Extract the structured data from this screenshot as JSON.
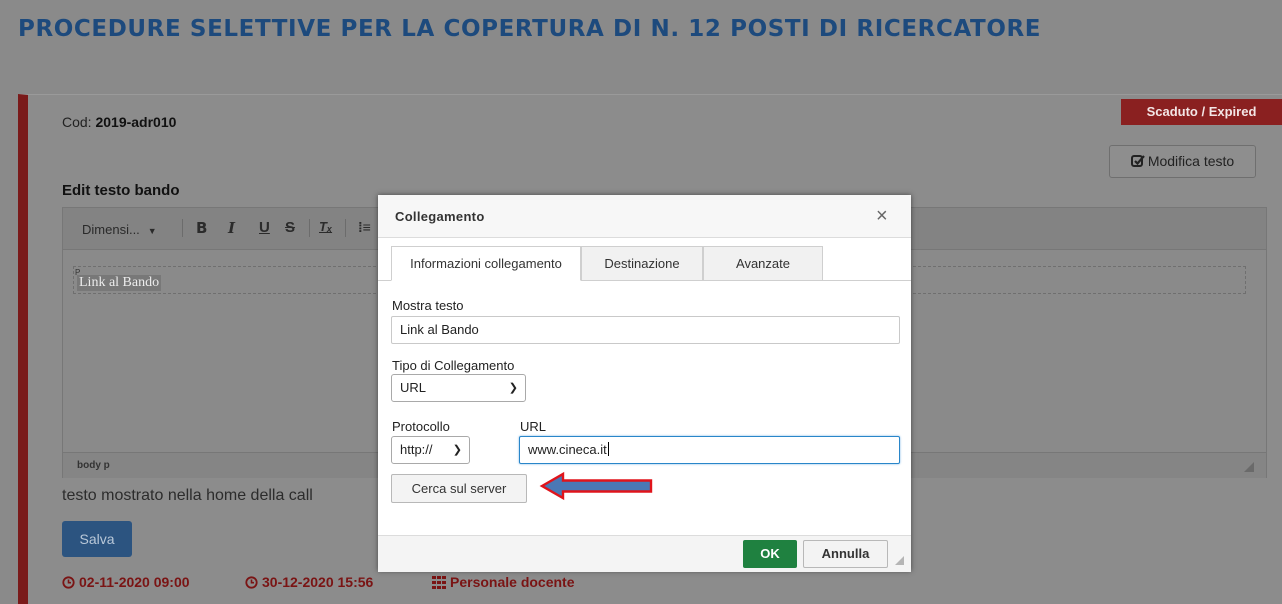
{
  "page": {
    "title": "PROCEDURE SELETTIVE PER LA COPERTURA DI N. 12 POSTI DI RICERCATORE"
  },
  "card": {
    "cod_label": "Cod:",
    "cod_value": "2019-adr010",
    "status_badge": "Scaduto / Expired",
    "modifica_label": "Modifica testo",
    "edit_label": "Edit testo bando",
    "hint": "testo mostrato nella home della call",
    "save_label": "Salva",
    "start_datetime": "02-11-2020 09:00",
    "end_datetime": "30-12-2020 15:56",
    "category": "Personale docente"
  },
  "editor": {
    "font_size_combo": "Dimensi...",
    "toolbar_buttons": [
      "B",
      "I",
      "U",
      "S",
      "Tx",
      "list"
    ],
    "p_marker": "P",
    "content_text": "Link al Bando",
    "status_path": "body  p"
  },
  "dialog": {
    "title": "Collegamento",
    "close_glyph": "×",
    "tabs": [
      {
        "label": "Informazioni collegamento",
        "active": true
      },
      {
        "label": "Destinazione",
        "active": false
      },
      {
        "label": "Avanzate",
        "active": false
      }
    ],
    "display_text_label": "Mostra testo",
    "display_text_value": "Link al Bando",
    "link_type_label": "Tipo di Collegamento",
    "link_type_value": "URL",
    "protocol_label": "Protocollo",
    "protocol_value": "http://",
    "url_label": "URL",
    "url_value": "www.cineca.it",
    "browse_server_label": "Cerca sul server",
    "ok_label": "OK",
    "cancel_label": "Annulla"
  },
  "colors": {
    "title": "#1d4a7d",
    "badge": "#8a2020",
    "ok_button": "#1f8140",
    "salva_button": "#2c5480",
    "accent_dark_red": "#7a1414",
    "annotation_arrow_fill": "#4a78b5",
    "annotation_arrow_stroke": "#e0141b"
  },
  "icons": {
    "modifica": "edit-check-icon",
    "start": "clock-icon",
    "end": "clock-icon",
    "category": "grid-icon",
    "annotation": "left-arrow-annotation"
  }
}
